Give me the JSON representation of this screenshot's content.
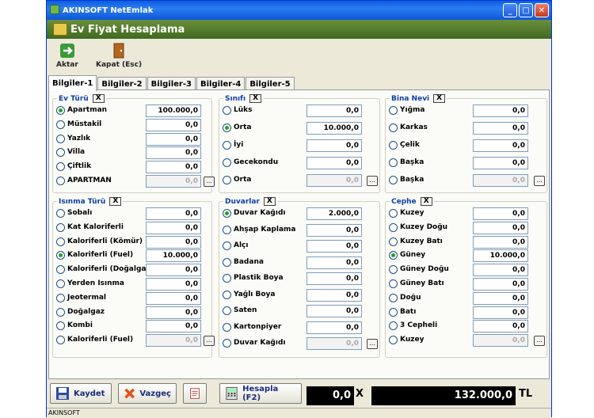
{
  "app_title": "AKINSOFT NetEmlak",
  "header_title": "Ev Fiyat Hesaplama",
  "toolbar": {
    "aktar": "Aktar",
    "kapat": "Kapat (Esc)"
  },
  "tabs": [
    "Bilgiler-1",
    "Bilgiler-2",
    "Bilgiler-3",
    "Bilgiler-4",
    "Bilgiler-5"
  ],
  "x_label": "X",
  "dots_label": "...",
  "groups": {
    "ev_turu": {
      "title": "Ev Türü",
      "items": [
        {
          "label": "Apartman",
          "value": "100.000,0",
          "selected": true
        },
        {
          "label": "Müstakil",
          "value": "0,0"
        },
        {
          "label": "Yazlık",
          "value": "0,0"
        },
        {
          "label": "Villa",
          "value": "0,0"
        },
        {
          "label": "Çiftlik",
          "value": "0,0"
        },
        {
          "label": "APARTMAN",
          "value": "0,0"
        }
      ]
    },
    "sinifi": {
      "title": "Sınıfı",
      "items": [
        {
          "label": "Lüks",
          "value": "0,0"
        },
        {
          "label": "Orta",
          "value": "10.000,0",
          "selected": true
        },
        {
          "label": "İyi",
          "value": "0,0"
        },
        {
          "label": "Gecekondu",
          "value": "0,0"
        },
        {
          "label": "Orta",
          "value": "0,0"
        }
      ]
    },
    "bina_nevi": {
      "title": "Bina Nevi",
      "items": [
        {
          "label": "Yığma",
          "value": "0,0"
        },
        {
          "label": "Karkas",
          "value": "0,0"
        },
        {
          "label": "Çelik",
          "value": "0,0"
        },
        {
          "label": "Başka",
          "value": "0,0"
        },
        {
          "label": "Başka",
          "value": "0,0"
        }
      ]
    },
    "isinma": {
      "title": "Isınma Türü",
      "items": [
        {
          "label": "Sobalı",
          "value": "0,0"
        },
        {
          "label": "Kat Kaloriferli",
          "value": "0,0"
        },
        {
          "label": "Kaloriferli (Kömür)",
          "value": "0,0"
        },
        {
          "label": "Kaloriferli (Fuel)",
          "value": "10.000,0",
          "selected": true
        },
        {
          "label": "Kaloriferli (Doğalgaz)",
          "value": "0,0"
        },
        {
          "label": "Yerden Isınma",
          "value": "0,0"
        },
        {
          "label": "Jeotermal",
          "value": "0,0"
        },
        {
          "label": "Doğalgaz",
          "value": "0,0"
        },
        {
          "label": "Kombi",
          "value": "0,0"
        },
        {
          "label": "Kaloriferli (Fuel)",
          "value": "0,0"
        }
      ]
    },
    "duvarlar": {
      "title": "Duvarlar",
      "items": [
        {
          "label": "Duvar Kağıdı",
          "value": "2.000,0",
          "selected": true
        },
        {
          "label": "Ahşap Kaplama",
          "value": "0,0"
        },
        {
          "label": "Alçı",
          "value": "0,0"
        },
        {
          "label": "Badana",
          "value": "0,0"
        },
        {
          "label": "Plastik Boya",
          "value": "0,0"
        },
        {
          "label": "Yağlı Boya",
          "value": "0,0"
        },
        {
          "label": "Saten",
          "value": "0,0"
        },
        {
          "label": "Kartonpiyer",
          "value": "0,0"
        },
        {
          "label": "Duvar Kağıdı",
          "value": "0,0"
        }
      ]
    },
    "cephe": {
      "title": "Cephe",
      "items": [
        {
          "label": "Kuzey",
          "value": "0,0"
        },
        {
          "label": "Kuzey Doğu",
          "value": "0,0"
        },
        {
          "label": "Kuzey Batı",
          "value": "0,0"
        },
        {
          "label": "Güney",
          "value": "10.000,0",
          "selected": true
        },
        {
          "label": "Güney Doğu",
          "value": "0,0"
        },
        {
          "label": "Güney Batı",
          "value": "0,0"
        },
        {
          "label": "Doğu",
          "value": "0,0"
        },
        {
          "label": "Batı",
          "value": "0,0"
        },
        {
          "label": "3 Cepheli",
          "value": "0,0"
        },
        {
          "label": "Kuzey",
          "value": "0,0"
        }
      ]
    }
  },
  "bottom": {
    "kaydet": "Kaydet",
    "vazgec": "Vazgeç",
    "hesapla": "Hesapla (F2)",
    "factor": "0,0",
    "times": "X",
    "total": "132.000,0",
    "currency": "TL"
  },
  "status": "AKINSOFT",
  "colors": {
    "title_bar": "#0a5fe0",
    "header": "#4e7a2a",
    "group_title": "#0a3fa6",
    "selected_radio": "#21a121"
  }
}
